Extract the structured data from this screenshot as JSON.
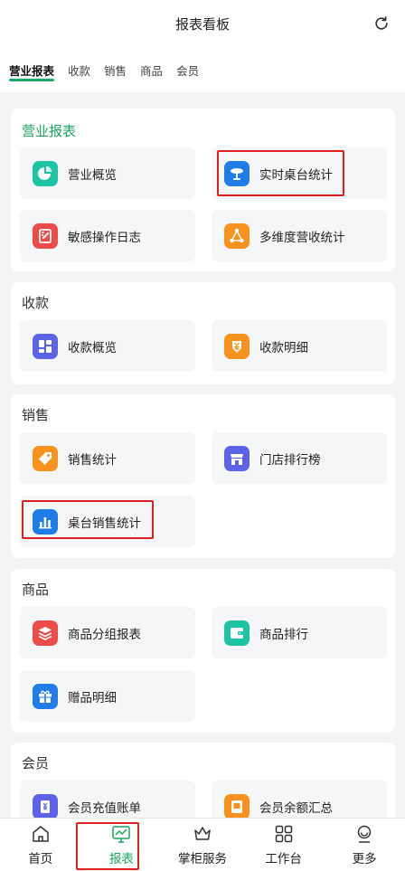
{
  "header": {
    "title": "报表看板",
    "refresh_icon": "refresh-icon"
  },
  "tabs": [
    {
      "label": "营业报表",
      "active": true
    },
    {
      "label": "收款",
      "active": false
    },
    {
      "label": "销售",
      "active": false
    },
    {
      "label": "商品",
      "active": false
    },
    {
      "label": "会员",
      "active": false
    }
  ],
  "sections": {
    "business": {
      "title": "营业报表",
      "items": [
        {
          "label": "营业概览",
          "icon": "pie-chart-icon",
          "color": "#1ec3a4"
        },
        {
          "label": "实时桌台统计",
          "icon": "table-icon",
          "color": "#1f7ce8"
        },
        {
          "label": "敏感操作日志",
          "icon": "log-edit-icon",
          "color": "#ee4c48"
        },
        {
          "label": "多维度营收统计",
          "icon": "dimension-icon",
          "color": "#f7921e"
        }
      ]
    },
    "payment": {
      "title": "收款",
      "items": [
        {
          "label": "收款概览",
          "icon": "grid-icon",
          "color": "#5c63e8"
        },
        {
          "label": "收款明细",
          "icon": "yen-icon",
          "color": "#f7921e"
        }
      ]
    },
    "sales": {
      "title": "销售",
      "items": [
        {
          "label": "销售统计",
          "icon": "tag-icon",
          "color": "#f7921e"
        },
        {
          "label": "门店排行榜",
          "icon": "store-icon",
          "color": "#5c63e8"
        },
        {
          "label": "桌台销售统计",
          "icon": "bar-chart-icon",
          "color": "#1f7ce8"
        }
      ]
    },
    "goods": {
      "title": "商品",
      "items": [
        {
          "label": "商品分组报表",
          "icon": "layers-icon",
          "color": "#ee4c48"
        },
        {
          "label": "商品排行",
          "icon": "wallet-icon",
          "color": "#1ec3a4"
        },
        {
          "label": "赠品明细",
          "icon": "gift-icon",
          "color": "#1f7ce8"
        }
      ]
    },
    "members": {
      "title": "会员",
      "items": [
        {
          "label": "会员充值账单",
          "icon": "recharge-icon",
          "color": "#5c63e8"
        },
        {
          "label": "会员余额汇总",
          "icon": "balance-icon",
          "color": "#f7921e"
        }
      ]
    }
  },
  "bottom_nav": [
    {
      "label": "首页",
      "icon": "home-icon",
      "active": false
    },
    {
      "label": "报表",
      "icon": "report-monitor-icon",
      "active": true
    },
    {
      "label": "掌柜服务",
      "icon": "crown-icon",
      "active": false
    },
    {
      "label": "工作台",
      "icon": "apps-grid-icon",
      "active": false
    },
    {
      "label": "更多",
      "icon": "more-icon",
      "active": false
    }
  ],
  "colors": {
    "accent": "#19a45f",
    "highlight": "#e02020"
  }
}
